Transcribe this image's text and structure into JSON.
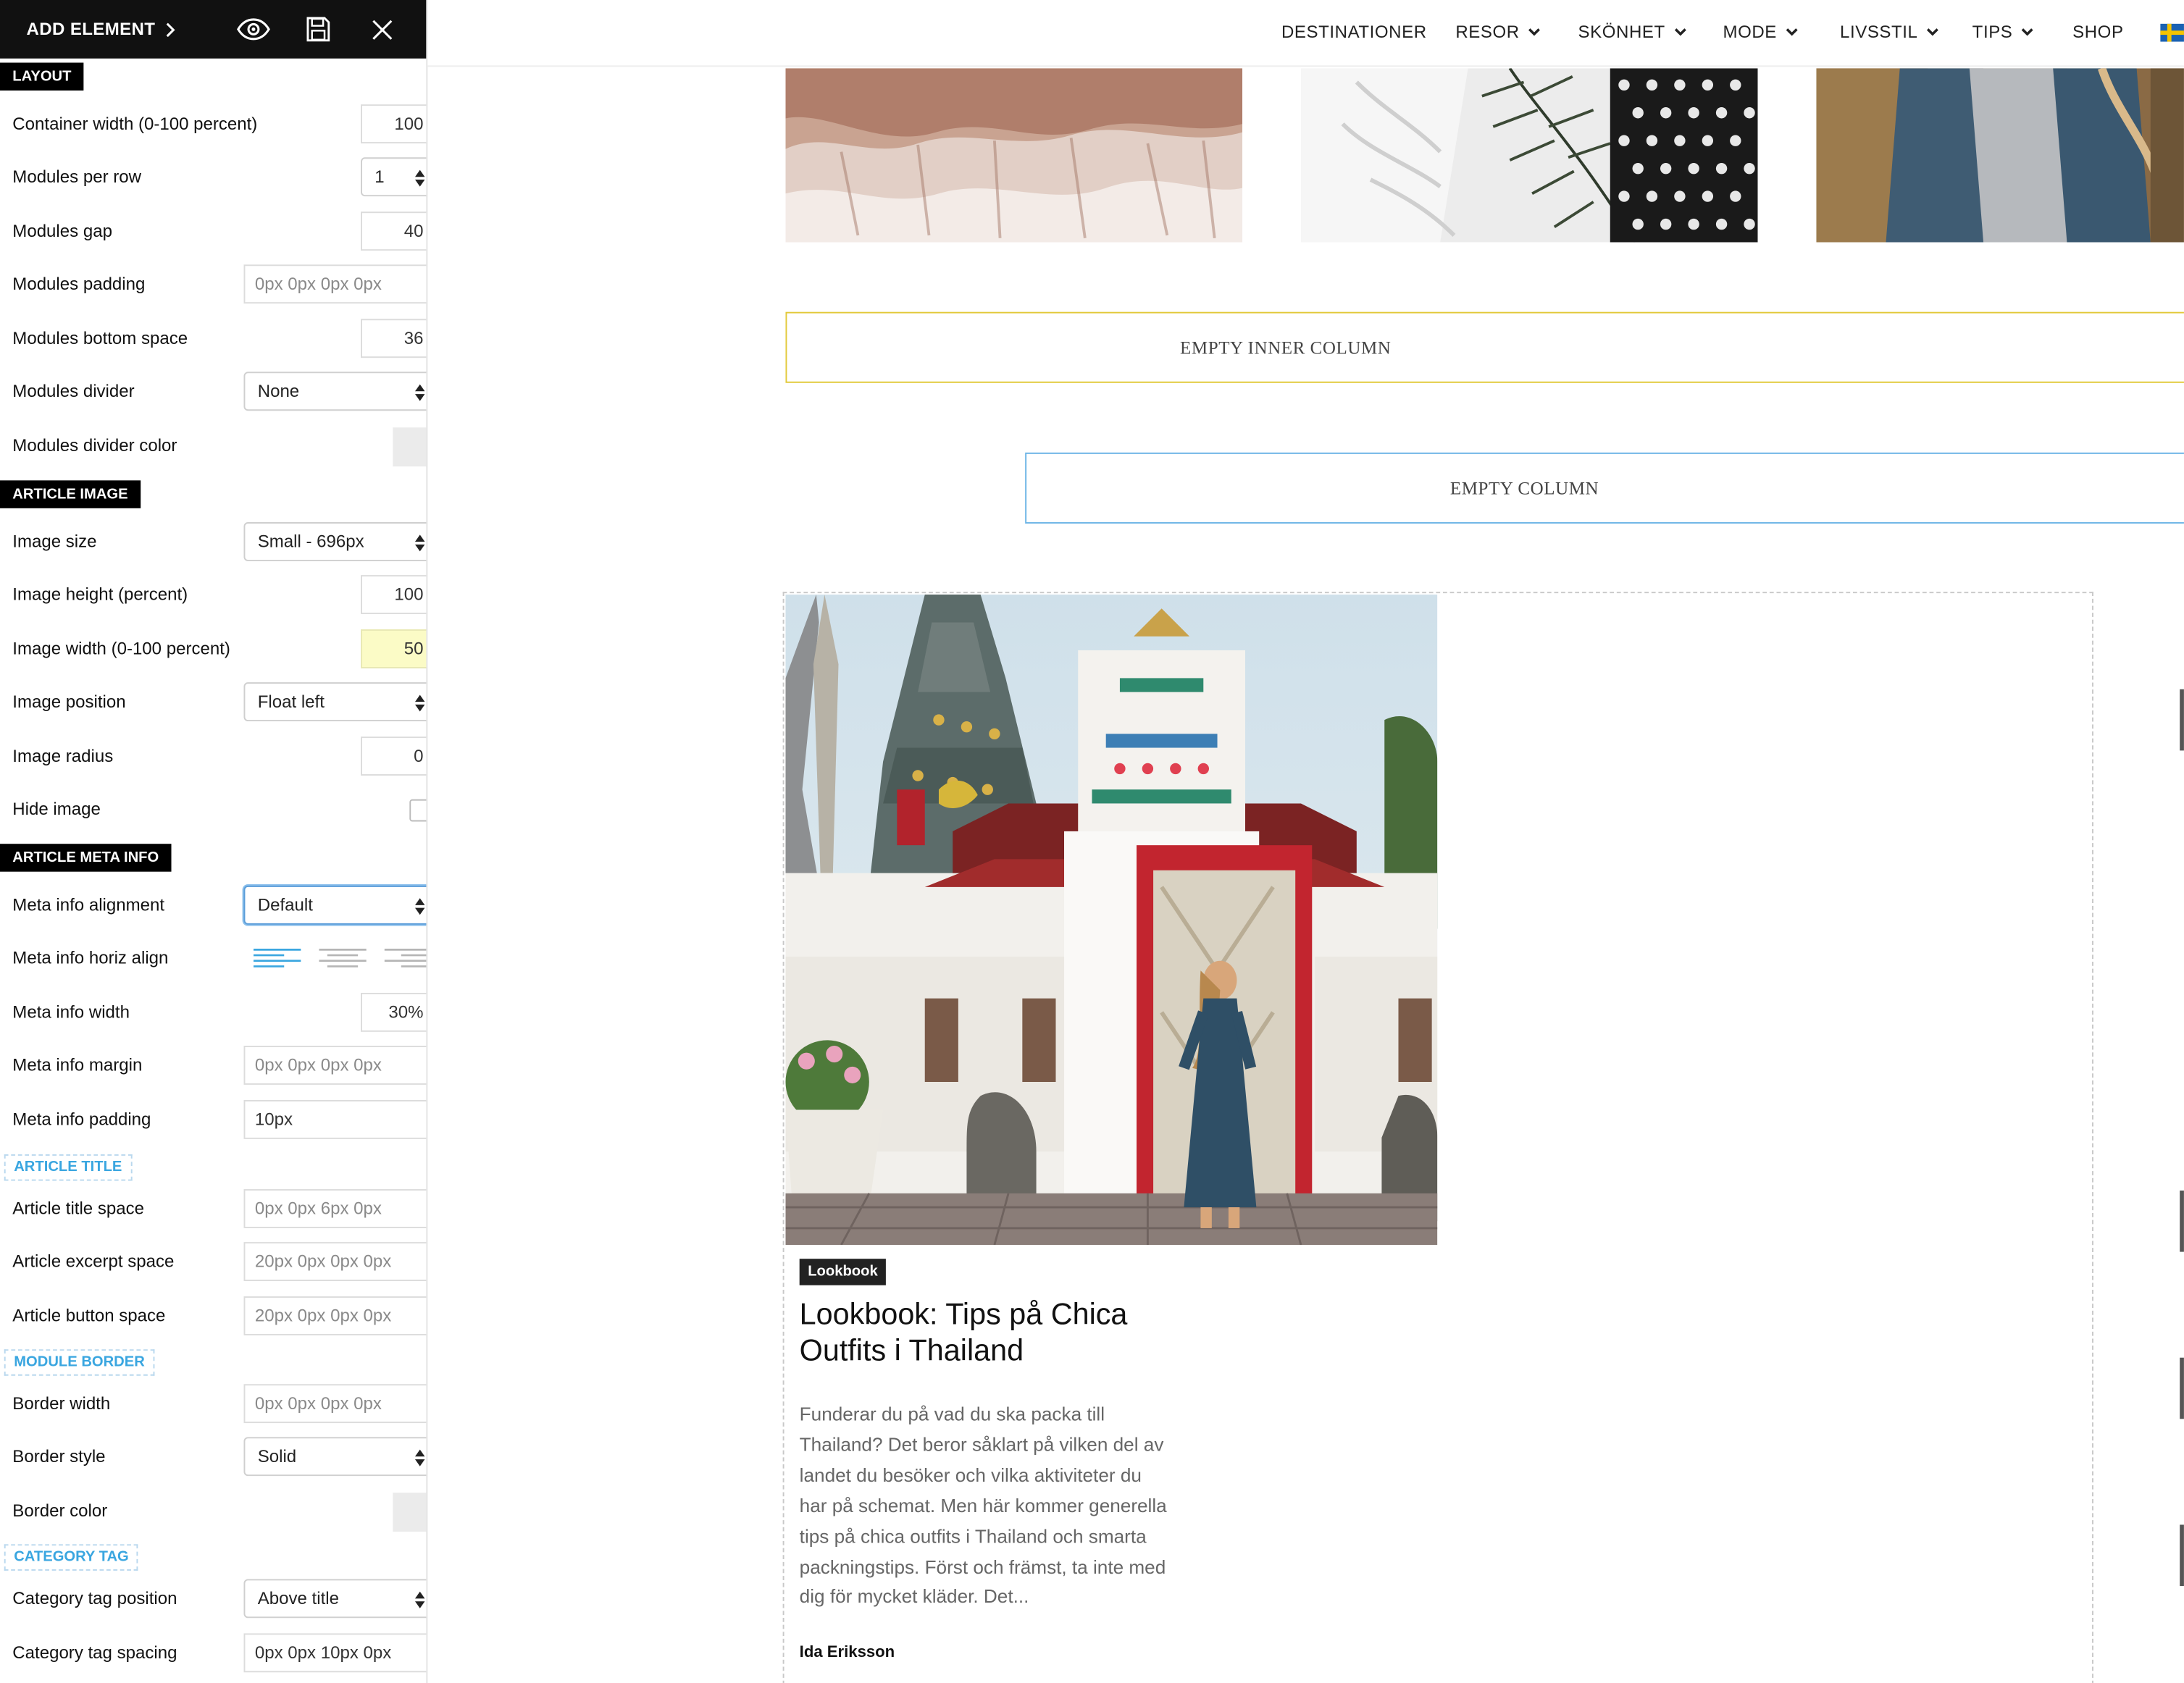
{
  "panel": {
    "add_element": "ADD ELEMENT",
    "sections": {
      "layout": "LAYOUT",
      "article_image": "ARTICLE IMAGE",
      "article_meta_info": "ARTICLE META INFO",
      "article_title": "ARTICLE TITLE",
      "module_border": "MODULE BORDER",
      "category_tag": "CATEGORY TAG"
    },
    "fields": {
      "container_width": {
        "label": "Container width (0-100 percent)",
        "value": "100"
      },
      "modules_per_row": {
        "label": "Modules per row",
        "value": "1"
      },
      "modules_gap": {
        "label": "Modules gap",
        "value": "40"
      },
      "modules_padding": {
        "label": "Modules padding",
        "placeholder": "0px 0px 0px 0px"
      },
      "modules_bottom_space": {
        "label": "Modules bottom space",
        "value": "36"
      },
      "modules_divider": {
        "label": "Modules divider",
        "value": "None"
      },
      "modules_divider_color": {
        "label": "Modules divider color"
      },
      "image_size": {
        "label": "Image size",
        "value": "Small - 696px"
      },
      "image_height": {
        "label": "Image height (percent)",
        "value": "100"
      },
      "image_width": {
        "label": "Image width (0-100 percent)",
        "value": "50"
      },
      "image_position": {
        "label": "Image position",
        "value": "Float left"
      },
      "image_radius": {
        "label": "Image radius",
        "value": "0"
      },
      "hide_image": {
        "label": "Hide image"
      },
      "meta_info_alignment": {
        "label": "Meta info alignment",
        "value": "Default"
      },
      "meta_info_horiz_align": {
        "label": "Meta info horiz align"
      },
      "meta_info_width": {
        "label": "Meta info width",
        "value": "30%"
      },
      "meta_info_margin": {
        "label": "Meta info margin",
        "placeholder": "0px 0px 0px 0px"
      },
      "meta_info_padding": {
        "label": "Meta info padding",
        "value": "10px"
      },
      "article_title_space": {
        "label": "Article title space",
        "placeholder": "0px 0px 6px 0px"
      },
      "article_excerpt_space": {
        "label": "Article excerpt space",
        "placeholder": "20px 0px 0px 0px"
      },
      "article_button_space": {
        "label": "Article button space",
        "placeholder": "20px 0px 0px 0px"
      },
      "border_width": {
        "label": "Border width",
        "placeholder": "0px 0px 0px 0px"
      },
      "border_style": {
        "label": "Border style",
        "value": "Solid"
      },
      "border_color": {
        "label": "Border color"
      },
      "category_tag_position": {
        "label": "Category tag position",
        "value": "Above title"
      },
      "category_tag_spacing": {
        "label": "Category tag spacing",
        "value": "0px 0px 10px 0px"
      }
    }
  },
  "nav": {
    "items": [
      "DESTINATIONER",
      "RESOR",
      "SKÖNHET",
      "MODE",
      "LIVSSTIL",
      "TIPS",
      "SHOP"
    ]
  },
  "content": {
    "empty_inner_column": "EMPTY INNER COLUMN",
    "empty_column": "EMPTY COLUMN",
    "article": {
      "category": "Lookbook",
      "title": "Lookbook: Tips på Chica Outfits i Thailand",
      "excerpt": "Funderar du på vad du ska packa till Thailand? Det beror såklart på vilken del av landet du besöker och vilka aktiviteter du har på schemat. Men här kommer generella tips på chica outfits i Thailand och smarta packningstips. Först och främst, ta inte med dig för mycket kläder. Det...",
      "author": "Ida Eriksson"
    }
  },
  "colors": {
    "accent": "#3aa6e0",
    "inner_column_border": "#e2c93a",
    "column_border": "#6cb4e6"
  }
}
